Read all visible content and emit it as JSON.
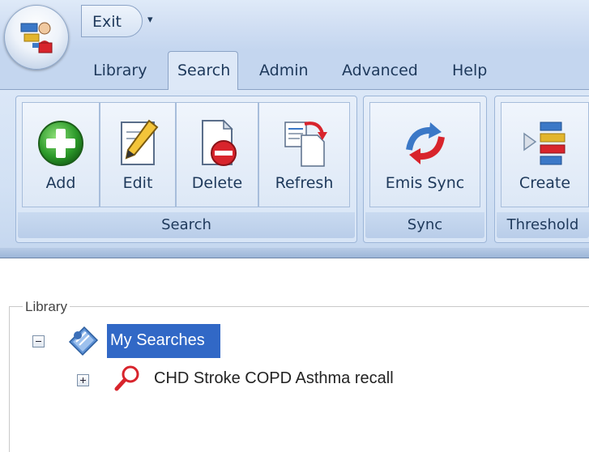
{
  "quick_access": {
    "exit_label": "Exit",
    "dropdown_glyph": "▾"
  },
  "tabs": [
    {
      "label": "Library"
    },
    {
      "label": "Search"
    },
    {
      "label": "Admin"
    },
    {
      "label": "Advanced"
    },
    {
      "label": "Help"
    }
  ],
  "ribbon": {
    "search_group": {
      "label": "Search",
      "buttons": [
        {
          "label": "Add",
          "icon": "add-icon"
        },
        {
          "label": "Edit",
          "icon": "pencil-icon"
        },
        {
          "label": "Delete",
          "icon": "delete-icon"
        },
        {
          "label": "Refresh",
          "icon": "refresh-icon"
        }
      ]
    },
    "sync_group": {
      "label": "Sync",
      "buttons": [
        {
          "label": "Emis Sync",
          "icon": "sync-icon"
        }
      ]
    },
    "threshold_group": {
      "label": "Threshold",
      "buttons": [
        {
          "label": "Create",
          "icon": "create-threshold-icon"
        }
      ]
    }
  },
  "library": {
    "legend": "Library",
    "root": {
      "label": "My Searches",
      "icon": "searches-folder-icon",
      "expanded": true
    },
    "children": [
      {
        "label": "CHD Stroke COPD Asthma recall",
        "icon": "magnifier-icon",
        "expanded": false
      }
    ]
  },
  "colors": {
    "ribbon_blue": "#d2e1f4",
    "selection": "#3168c6",
    "text_dark_blue": "#1e395b"
  }
}
